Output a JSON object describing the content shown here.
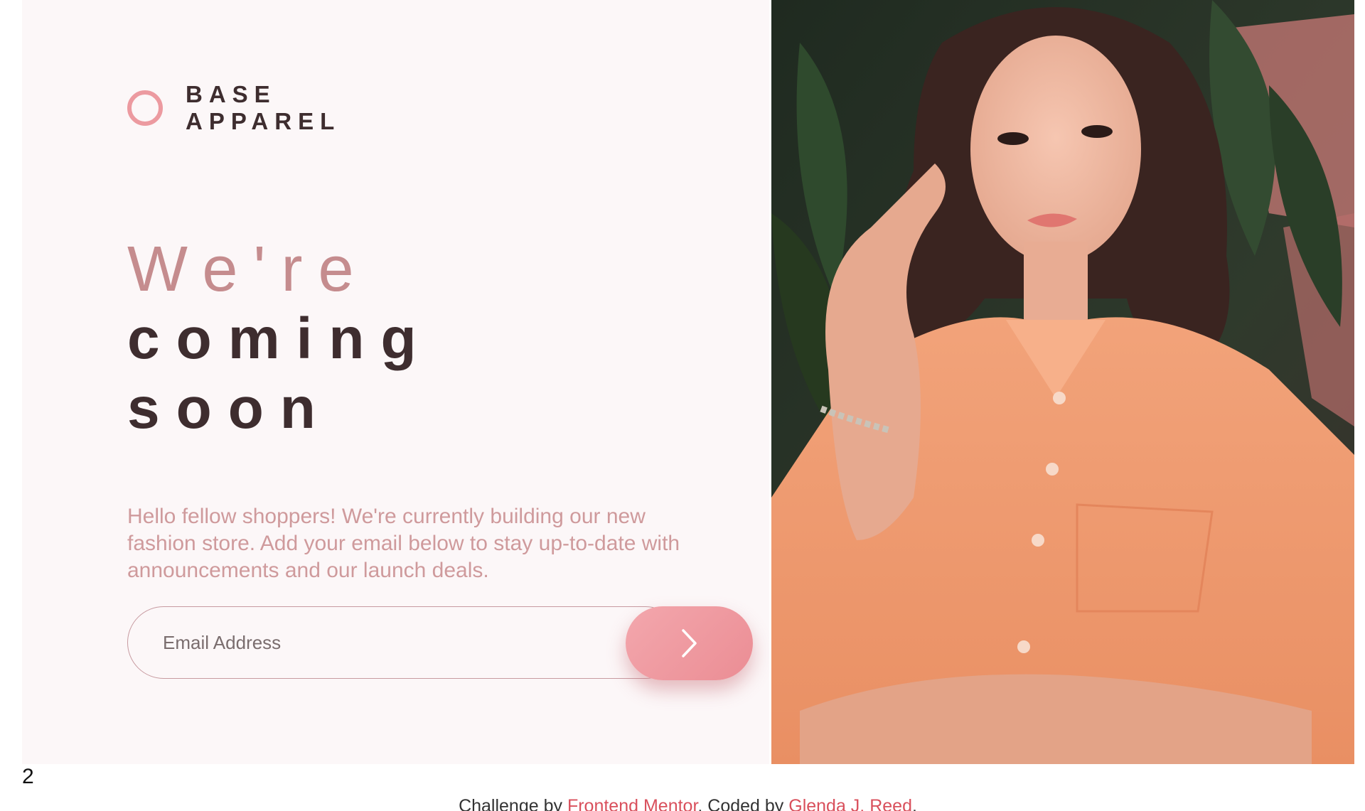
{
  "brand": {
    "line1": "BASE",
    "line2": "APPAREL",
    "accent_color": "#ec9aa0"
  },
  "hero": {
    "line1": "We're",
    "line2": "coming",
    "line3": "soon",
    "description": "Hello fellow shoppers! We're currently building our new fashion store. Add your email below to stay up-to-date with announcements and our launch deals."
  },
  "form": {
    "email_placeholder": "Email Address",
    "submit_icon": "chevron-right-icon"
  },
  "photo": {
    "icon": "hero-model-photo"
  },
  "page_number": "2",
  "footer": {
    "prefix": "Challenge by ",
    "challenge_link": "Frontend Mentor",
    "middle": ". Coded by ",
    "author_link": "Glenda J. Reed",
    "suffix": ".",
    "link_color": "#d9505c"
  }
}
